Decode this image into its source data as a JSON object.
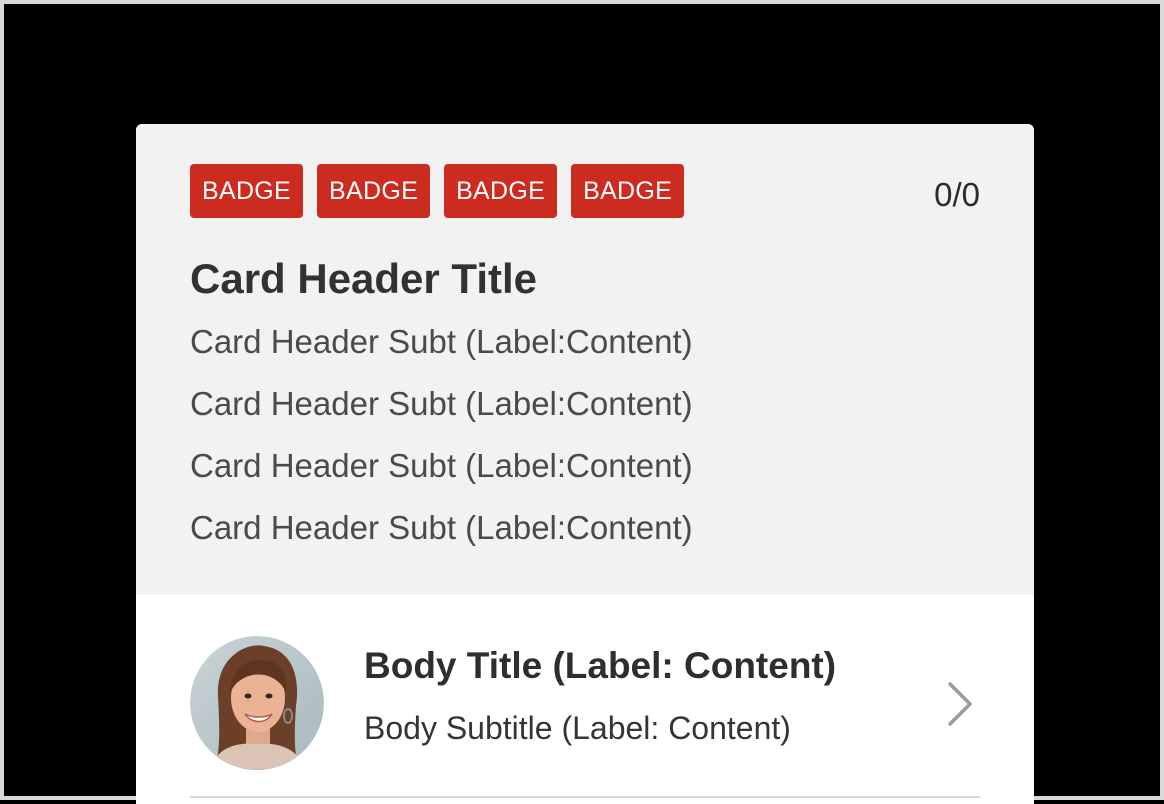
{
  "card": {
    "badges": [
      "BADGE",
      "BADGE",
      "BADGE",
      "BADGE"
    ],
    "counter": "0/0",
    "title": "Card Header Title",
    "subtitles": [
      "Card Header Subt (Label:Content)",
      "Card Header Subt (Label:Content)",
      "Card Header Subt (Label:Content)",
      "Card Header Subt (Label:Content)"
    ]
  },
  "body": {
    "title": "Body Title (Label: Content)",
    "subtitle": "Body Subtitle (Label: Content)",
    "avatar_icon": "person-photo",
    "chevron_icon": "chevron-right-icon"
  },
  "colors": {
    "badge": "#cc2b1f",
    "header_bg": "#f2f2f2",
    "page_bg": "#000000"
  }
}
